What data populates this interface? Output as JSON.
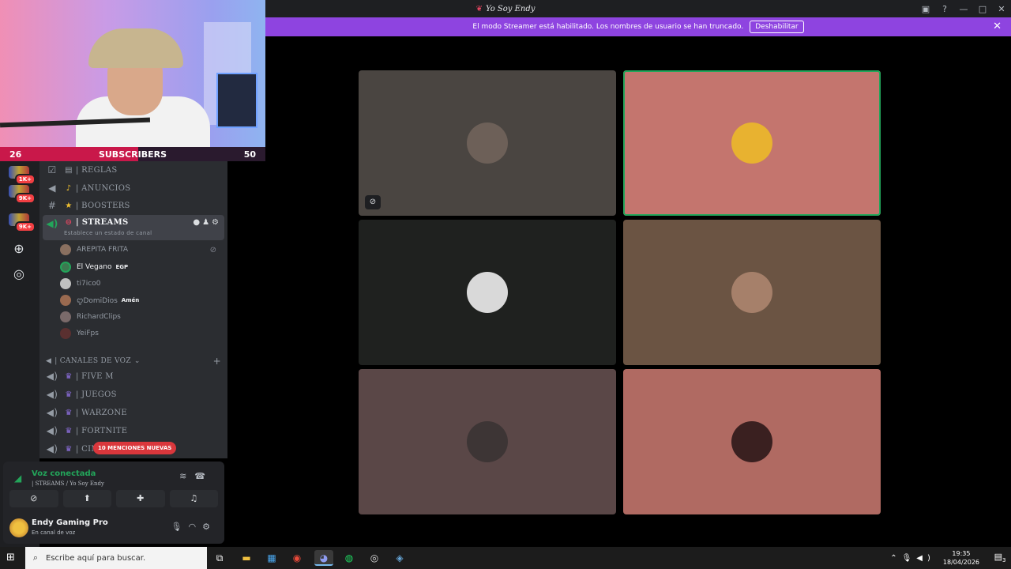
{
  "window": {
    "title": "Yo Soy Endy",
    "controls": [
      "inbox-icon",
      "help-icon",
      "minimize-icon",
      "maximize-icon",
      "close-icon"
    ]
  },
  "banner": {
    "text": "El modo Streamer está habilitado. Los nombres de usuario se han truncado.",
    "button": "Deshabilitar",
    "color": "#8e44e0"
  },
  "webcam": {
    "subs_current": "26",
    "subs_label": "SUBSCRIBERS",
    "subs_goal": "50",
    "progress": 0.52
  },
  "servers": [
    {
      "badge": "1K+"
    },
    {
      "badge": "9K+"
    },
    {
      "badge": "9K+"
    }
  ],
  "channels": [
    {
      "emoji": "📗",
      "name": "| REGLAS"
    },
    {
      "emoji": "🔔",
      "name": "| ANUNCIOS"
    },
    {
      "emoji": "⭐",
      "name": "| BOOSTERS"
    }
  ],
  "active_channel": {
    "name": "| STREAMS",
    "subtitle": "Establece un estado de canal"
  },
  "voice_users": [
    {
      "name": "AREPITA FRITA",
      "tag": "",
      "muted": true
    },
    {
      "name": "El Vegano",
      "tag": "EGP",
      "muted": false
    },
    {
      "name": "ti7ico0",
      "tag": "",
      "muted": false
    },
    {
      "name": "ꨄDomiDios",
      "tag": "Amén",
      "muted": false
    },
    {
      "name": "RichardClips",
      "tag": "",
      "muted": false
    },
    {
      "name": "YeiFps",
      "tag": "",
      "muted": false
    }
  ],
  "voice_category": "| CANALES DE VOZ",
  "voice_channels": [
    "| FIVE M",
    "| JUEGOS",
    "| WARZONE",
    "| FORTNITE",
    "| CIN"
  ],
  "mentions_pill": "10 MENCIONES NUEVAS",
  "voice_panel": {
    "status": "Voz conectada",
    "channel": "| STREAMS / Yo Soy Endy"
  },
  "user": {
    "name": "Endy Gaming Pro",
    "status": "En canal de voz"
  },
  "tiles": [
    {
      "bg": "#4a4541",
      "avatar_bg": "#6d6058",
      "muted": true,
      "speaking": false
    },
    {
      "bg": "#c4756e",
      "avatar_bg": "#e8b230",
      "muted": false,
      "speaking": true
    },
    {
      "bg": "#1f211f",
      "avatar_bg": "#d9d9d9",
      "muted": false,
      "speaking": false
    },
    {
      "bg": "#6b5443",
      "avatar_bg": "#a6806a",
      "muted": false,
      "speaking": false
    },
    {
      "bg": "#5a4747",
      "avatar_bg": "#3d3535",
      "muted": false,
      "speaking": false
    },
    {
      "bg": "#b06a62",
      "avatar_bg": "#3a2020",
      "muted": false,
      "speaking": false
    }
  ],
  "taskbar": {
    "search_placeholder": "Escribe aquí para buscar.",
    "time": "19:35",
    "date": "18/04/2026",
    "notifications": "3"
  }
}
